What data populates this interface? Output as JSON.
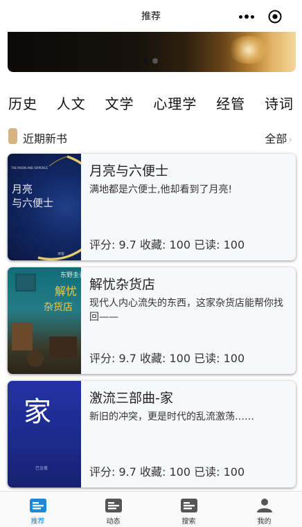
{
  "nav": {
    "title": "推荐"
  },
  "banner": {
    "pages": 2,
    "active_page": 1
  },
  "categories": [
    "历史",
    "人文",
    "文学",
    "心理学",
    "经管",
    "诗词"
  ],
  "section": {
    "title": "近期新书",
    "more_label": "全部",
    "chevron": "›"
  },
  "books": [
    {
      "title": "月亮与六便士",
      "desc": "满地都是六便士,他却看到了月亮!",
      "stats": "评分: 9.7 收藏: 100 已读: 100",
      "cover": {
        "title_line1": "月亮",
        "title_line2": "与六便士",
        "top_text": "THE MOON AND SIXPENCE",
        "bottom_text": "读客"
      }
    },
    {
      "title": "解忧杂货店",
      "desc": "现代人内心流失的东西，这家杂货店能帮你找回——",
      "stats": "评分: 9.7 收藏: 100 已读: 100",
      "cover": {
        "title_line1": "解忧",
        "title_line2": "杂货店",
        "author_text": "东野圭吾"
      }
    },
    {
      "title": "激流三部曲-家",
      "desc": "新旧的冲突，更是时代的乱流激荡……",
      "stats": "评分: 9.7 收藏: 100 已读: 100",
      "cover": {
        "title_text": "家",
        "bottom_text": "巴金著"
      }
    }
  ],
  "tabs": [
    {
      "label": "推荐",
      "icon": "list-icon",
      "active": true
    },
    {
      "label": "动态",
      "icon": "list-icon",
      "active": false
    },
    {
      "label": "搜索",
      "icon": "list-icon",
      "active": false
    },
    {
      "label": "我的",
      "icon": "person-icon",
      "active": false
    }
  ],
  "colors": {
    "accent": "#1e88d6",
    "marker": "#d8b483",
    "card_bg": "#f7f8fc"
  }
}
